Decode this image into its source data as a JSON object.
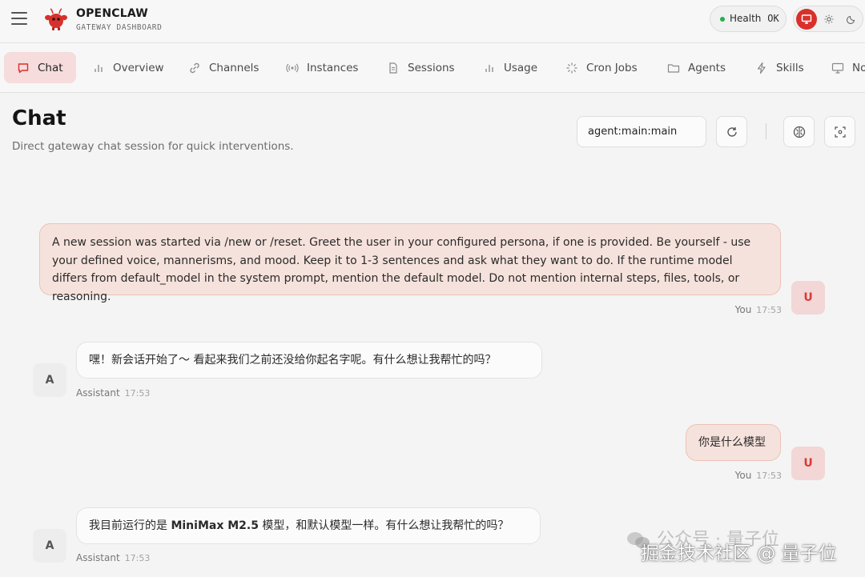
{
  "app": {
    "brand": "OPENCLAW",
    "subtitle": "GATEWAY DASHBOARD",
    "health_label": "Health",
    "health_status": "OK",
    "health_color": "#22b14c",
    "accent_color": "#d9302b"
  },
  "nav": {
    "tabs": [
      {
        "label": "Chat",
        "icon": "chat-bubble-icon",
        "active": true
      },
      {
        "label": "Overview",
        "icon": "bar-chart-icon"
      },
      {
        "label": "Channels",
        "icon": "link-icon"
      },
      {
        "label": "Instances",
        "icon": "radio-broadcast-icon"
      },
      {
        "label": "Sessions",
        "icon": "document-icon"
      },
      {
        "label": "Usage",
        "icon": "bar-chart-icon"
      },
      {
        "label": "Cron Jobs",
        "icon": "loader-icon"
      },
      {
        "label": "Agents",
        "icon": "folder-icon"
      },
      {
        "label": "Skills",
        "icon": "lightning-icon"
      },
      {
        "label": "No",
        "icon": "monitor-icon"
      }
    ]
  },
  "page": {
    "title": "Chat",
    "subtitle": "Direct gateway chat session for quick interventions.",
    "session_value": "agent:main:main"
  },
  "messages": [
    {
      "role": "user",
      "text": "A new session was started via /new or /reset. Greet the user in your configured persona, if one is provided. Be yourself - use your defined voice, mannerisms, and mood. Keep it to 1-3 sentences and ask what they want to do. If the runtime model differs from default_model in the system prompt, mention the default model. Do not mention internal steps, files, tools, or reasoning.",
      "sender": "You",
      "time": "17:53",
      "avatar": "U"
    },
    {
      "role": "assistant",
      "text": "嘿！新会话开始了～ 看起来我们之前还没给你起名字呢。有什么想让我帮忙的吗？",
      "sender": "Assistant",
      "time": "17:53",
      "avatar": "A"
    },
    {
      "role": "user",
      "text": "你是什么模型",
      "sender": "You",
      "time": "17:53",
      "avatar": "U"
    },
    {
      "role": "assistant",
      "text_before": "我目前运行的是 ",
      "text_bold": "MiniMax M2.5",
      "text_after": " 模型，和默认模型一样。有什么想让我帮忙的吗？",
      "sender": "Assistant",
      "time": "17:53",
      "avatar": "A"
    }
  ],
  "watermark": {
    "line1": "公众号 · 量子位",
    "line2": "掘金技术社区 @ 量子位"
  }
}
